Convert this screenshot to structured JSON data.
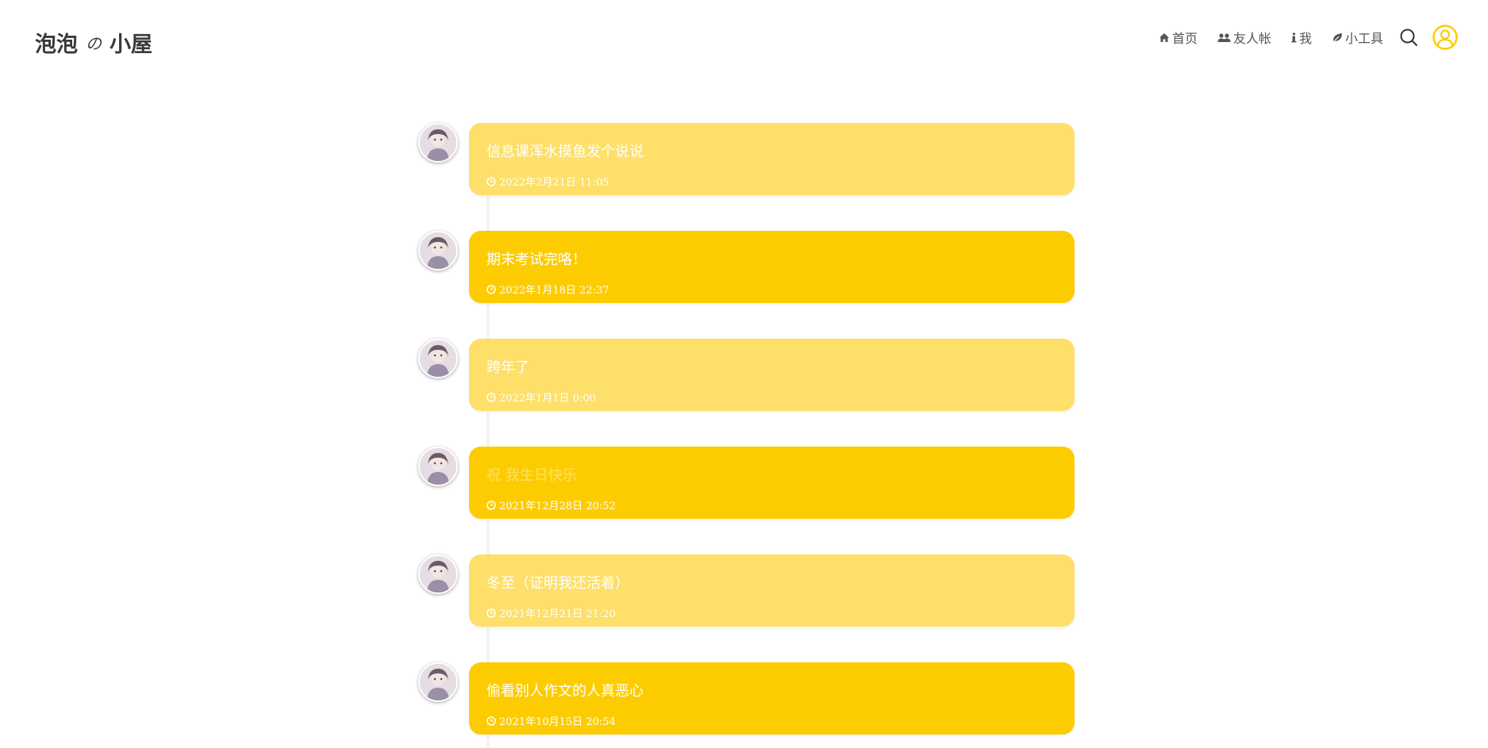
{
  "site": {
    "logo_main": "泡泡",
    "logo_no": "の",
    "logo_sub": "小屋"
  },
  "nav": {
    "items": [
      {
        "label": "首页",
        "icon": "home-icon"
      },
      {
        "label": "友人帐",
        "icon": "users-icon"
      },
      {
        "label": "我",
        "icon": "info-icon"
      },
      {
        "label": "小工具",
        "icon": "leaf-icon"
      }
    ],
    "search_icon": "search-icon",
    "user_icon": "user-avatar-icon"
  },
  "colors": {
    "accent": "#fdcc00",
    "accent_light": "#fddf6a"
  },
  "posts": [
    {
      "text": "信息课浑水摸鱼发个说说",
      "time": "2022年2月21日 11:05",
      "style": "light"
    },
    {
      "text": "期末考试完咯！",
      "time": "2022年1月18日 22:37",
      "style": "dark"
    },
    {
      "text": "跨年了",
      "time": "2022年1月1日 0:00",
      "style": "light"
    },
    {
      "text": "祝 我生日快乐",
      "time": "2021年12月28日 20:52",
      "style": "dark"
    },
    {
      "text": "冬至（证明我还活着）",
      "time": "2021年12月21日 21:20",
      "style": "light"
    },
    {
      "text": "偷看别人作文的人真恶心",
      "time": "2021年10月15日 20:54",
      "style": "dark"
    }
  ]
}
